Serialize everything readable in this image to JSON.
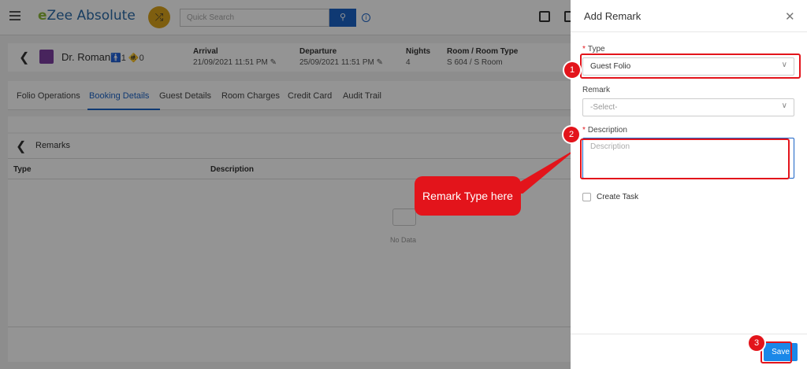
{
  "topbar": {
    "logo_prefix": "e",
    "logo_text": "Zee Absolute",
    "search_placeholder": "Quick Search"
  },
  "guest": {
    "name": "Dr. Roman",
    "adults": "1",
    "children": "0",
    "arrival_label": "Arrival",
    "arrival_value": "21/09/2021 11:51 PM",
    "departure_label": "Departure",
    "departure_value": "25/09/2021 11:51 PM",
    "nights_label": "Nights",
    "nights_value": "4",
    "room_label": "Room / Room Type",
    "room_value": "S 604 / S Room"
  },
  "tabs": [
    {
      "label": "Folio Operations"
    },
    {
      "label": "Booking Details",
      "active": true
    },
    {
      "label": "Guest Details"
    },
    {
      "label": "Room Charges"
    },
    {
      "label": "Credit Card"
    },
    {
      "label": "Audit Trail"
    }
  ],
  "remarks_panel": {
    "title": "Remarks",
    "col_type": "Type",
    "col_description": "Description",
    "empty_text": "No Data"
  },
  "callout": {
    "text": "Remark Type here"
  },
  "drawer": {
    "title": "Add Remark",
    "type_label": "Type",
    "type_value": "Guest Folio",
    "remark_label": "Remark",
    "remark_placeholder": "-Select-",
    "description_label": "Description",
    "description_placeholder": "Description",
    "create_task_label": "Create Task",
    "save_label": "Save"
  },
  "annotations": {
    "step1": "1",
    "step2": "2",
    "step3": "3",
    "highlight_color": "#e3141b"
  },
  "colors": {
    "accent": "#1b63c6",
    "save_button": "#1b88e8",
    "logo_green": "#8cb83b",
    "shuffle_gold": "#d9a31b"
  }
}
